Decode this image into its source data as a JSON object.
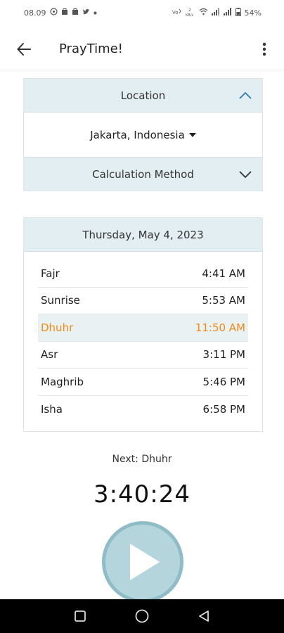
{
  "status_bar": {
    "time": "08.09",
    "battery": "54%",
    "left_icons": [
      "whatsapp-icon",
      "bag-icon",
      "bag-icon",
      "twitter-icon",
      "dot-icon"
    ],
    "right_icons": [
      "volte-icon",
      "data-speed-icon",
      "wifi-icon",
      "signal-icon",
      "signal-icon",
      "battery-icon"
    ],
    "speed": "2"
  },
  "app_bar": {
    "title": "PrayTime!",
    "back_icon": "arrow-left-icon",
    "menu_icon": "more-vert-icon"
  },
  "location_card": {
    "header": "Location",
    "header_icon": "chevron-up-icon",
    "selected_location": "Jakarta, Indonesia",
    "calc_header": "Calculation Method",
    "calc_icon": "chevron-down-icon"
  },
  "times_card": {
    "date": "Thursday, May 4, 2023",
    "prayers": [
      {
        "name": "Fajr",
        "time": "4:41 AM"
      },
      {
        "name": "Sunrise",
        "time": "5:53 AM"
      },
      {
        "name": "Dhuhr",
        "time": "11:50 AM"
      },
      {
        "name": "Asr",
        "time": "3:11 PM"
      },
      {
        "name": "Maghrib",
        "time": "5:46 PM"
      },
      {
        "name": "Isha",
        "time": "6:58 PM"
      }
    ],
    "highlight_color": "#ef8b17"
  },
  "next": {
    "label": "Next: Dhuhr",
    "countdown": "3:40:24"
  },
  "play_button": {
    "icon": "play-icon"
  },
  "nav_bar": {
    "icons": [
      "recents-square-icon",
      "home-circle-icon",
      "back-triangle-icon"
    ]
  },
  "colors": {
    "card_header_bg": "#e3eef2",
    "accent": "#2b7bbd",
    "play_fill": "#b5d5dd",
    "play_border": "#8fbcc6"
  }
}
